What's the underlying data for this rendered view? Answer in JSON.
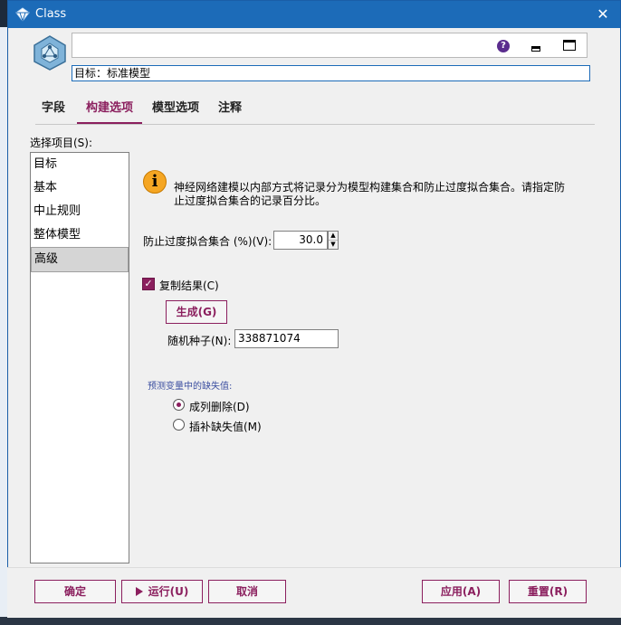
{
  "window": {
    "title": "Class",
    "close_glyph": "✕"
  },
  "header": {
    "node_name": "",
    "target_text": "目标：标准模型",
    "help_glyph": "?"
  },
  "tabs": [
    {
      "label": "字段",
      "active": false
    },
    {
      "label": "构建选项",
      "active": true
    },
    {
      "label": "模型选项",
      "active": false
    },
    {
      "label": "注释",
      "active": false
    }
  ],
  "left_panel": {
    "label": "选择项目(S):",
    "items": [
      {
        "label": "目标",
        "selected": false
      },
      {
        "label": "基本",
        "selected": false
      },
      {
        "label": "中止规则",
        "selected": false
      },
      {
        "label": "整体模型",
        "selected": false
      },
      {
        "label": "高级",
        "selected": true
      }
    ]
  },
  "advanced": {
    "info_glyph": "i",
    "info_text": "神经网络建模以内部方式将记录分为模型构建集合和防止过度拟合集合。请指定防止过度拟合集合的记录百分比。",
    "overfit_label": "防止过度拟合集合 (%)(V):",
    "overfit_value": "30.0",
    "replicate_label": "复制结果(C)",
    "replicate_checked": true,
    "generate_label": "生成(G)",
    "seed_label": "随机种子(N):",
    "seed_value": "338871074",
    "missing_title": "预测变量中的缺失值:",
    "missing_options": [
      {
        "label": "成列删除(D)",
        "checked": true
      },
      {
        "label": "插补缺失值(M)",
        "checked": false
      }
    ]
  },
  "buttons": {
    "ok": "确定",
    "run": "运行(U)",
    "cancel": "取消",
    "apply": "应用(A)",
    "reset": "重置(R)"
  },
  "colors": {
    "accent": "#8b1f5e",
    "titlebar": "#1c6bb8",
    "info": "#f5a623"
  }
}
